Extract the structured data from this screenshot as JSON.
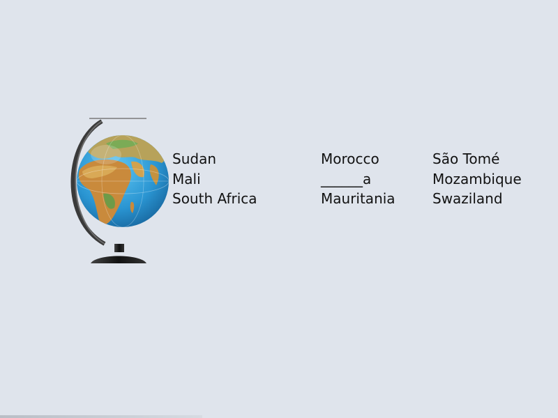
{
  "columns": [
    {
      "items": [
        "Sudan",
        "Mali",
        "South Africa"
      ]
    },
    {
      "items": [
        "Morocco",
        "______a",
        "Mauritania"
      ]
    },
    {
      "items": [
        "São Tomé",
        "Mozambique",
        "Swaziland"
      ]
    }
  ],
  "colors": {
    "background": "#dfe4ec",
    "ocean": "#2a9bd6",
    "land": "#c99a45",
    "stand": "#1e1e1e",
    "text": "#111111"
  },
  "icons": {
    "globe": "globe-icon"
  }
}
